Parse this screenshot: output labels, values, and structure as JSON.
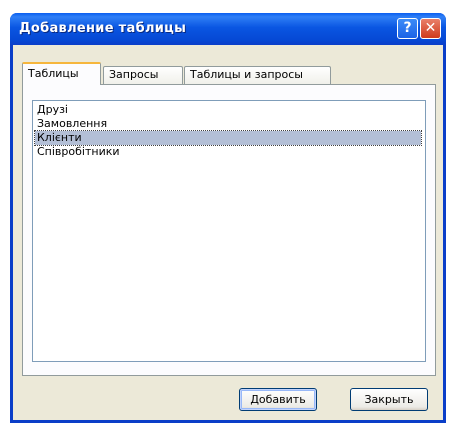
{
  "window": {
    "title": "Добавление таблицы"
  },
  "titlebar_buttons": {
    "help": "?",
    "close": "✕"
  },
  "tabs": [
    {
      "label": "Таблицы",
      "active": true
    },
    {
      "label": "Запросы",
      "active": false
    },
    {
      "label": "Таблицы и запросы",
      "active": false
    }
  ],
  "list": {
    "items": [
      {
        "label": "Друзі",
        "selected": false
      },
      {
        "label": "Замовлення",
        "selected": false
      },
      {
        "label": "Клієнти",
        "selected": true
      },
      {
        "label": "Співробітники",
        "selected": false
      }
    ]
  },
  "buttons": {
    "add_label": "Добавить",
    "close_label": "Закрыть"
  },
  "colors": {
    "titlebar": "#0a56e2",
    "dialog_face": "#ece9d8",
    "active_tab_highlight": "#f6b63c",
    "selection": "#b3bfd6"
  }
}
